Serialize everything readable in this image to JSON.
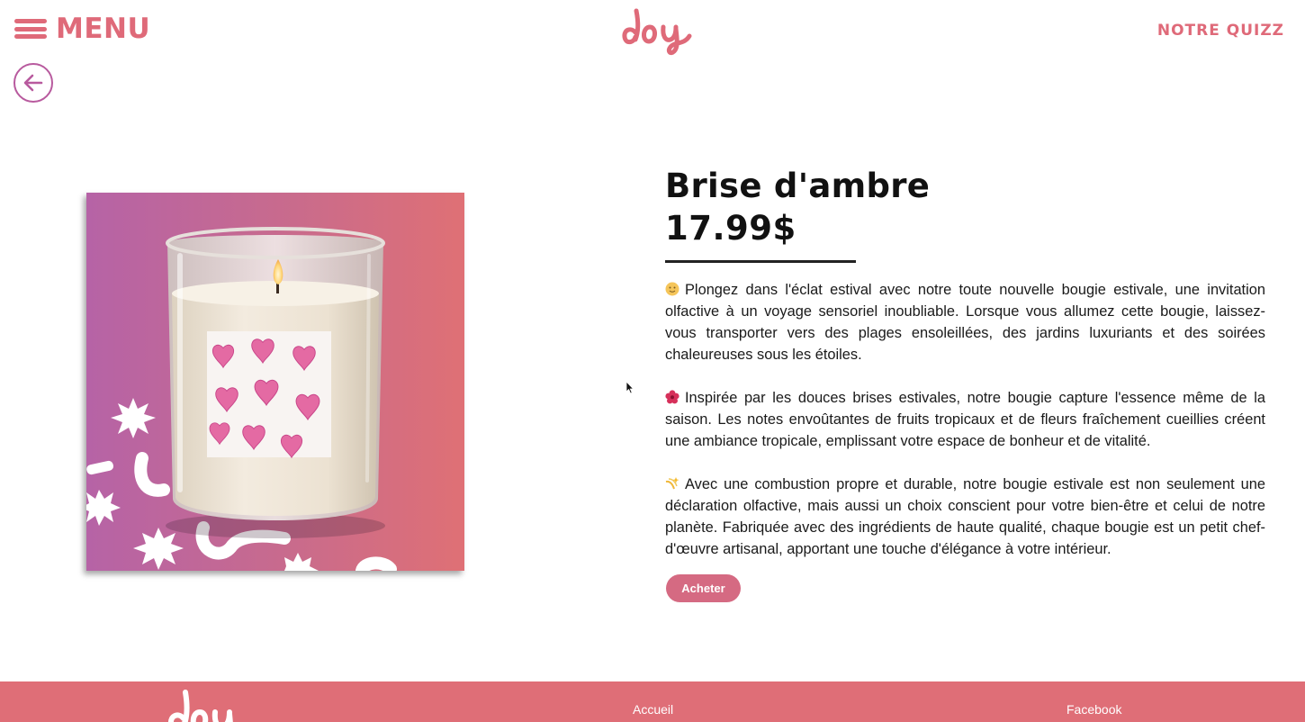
{
  "header": {
    "menu_label": "MENU",
    "logo_icon": "joy-logo-icon",
    "quiz_label": "NOTRE QUIZZ",
    "back_icon": "arrow-left-icon"
  },
  "product": {
    "title": "Brise d'ambre",
    "price": "17.99$",
    "image": "candle-product-image",
    "description": [
      {
        "icon": "smile-emoji-icon",
        "text": "Plongez dans l'éclat estival avec notre toute nouvelle bougie estivale, une invitation olfactive à un voyage sensoriel inoubliable. Lorsque vous allumez cette bougie, laissez-vous transporter vers des plages ensoleillées, des jardins luxuriants et des soirées chaleureuses sous les étoiles."
      },
      {
        "icon": "hibiscus-emoji-icon",
        "text": "Inspirée par les douces brises estivales, notre bougie capture l'essence même de la saison. Les notes envoûtantes de fruits tropicaux et de fleurs fraîchement cueillies créent une ambiance tropicale, emplissant votre espace de bonheur et de vitalité."
      },
      {
        "icon": "sparkle-emoji-icon",
        "text": "Avec une combustion propre et durable, notre bougie estivale est non seulement une déclaration olfactive, mais aussi un choix conscient pour votre bien-être et celui de notre planète. Fabriquée avec des ingrédients de haute qualité, chaque bougie est un petit chef-d'œuvre artisanal, apportant une touche d'élégance à votre intérieur."
      }
    ],
    "buy_label": "Acheter"
  },
  "footer": {
    "home_label": "Accueil",
    "facebook_label": "Facebook"
  },
  "colors": {
    "brand_pink": "#df6a79",
    "back_purple": "#b85a9e",
    "button_pink": "#d56a82",
    "footer_bg": "#df6e77"
  }
}
